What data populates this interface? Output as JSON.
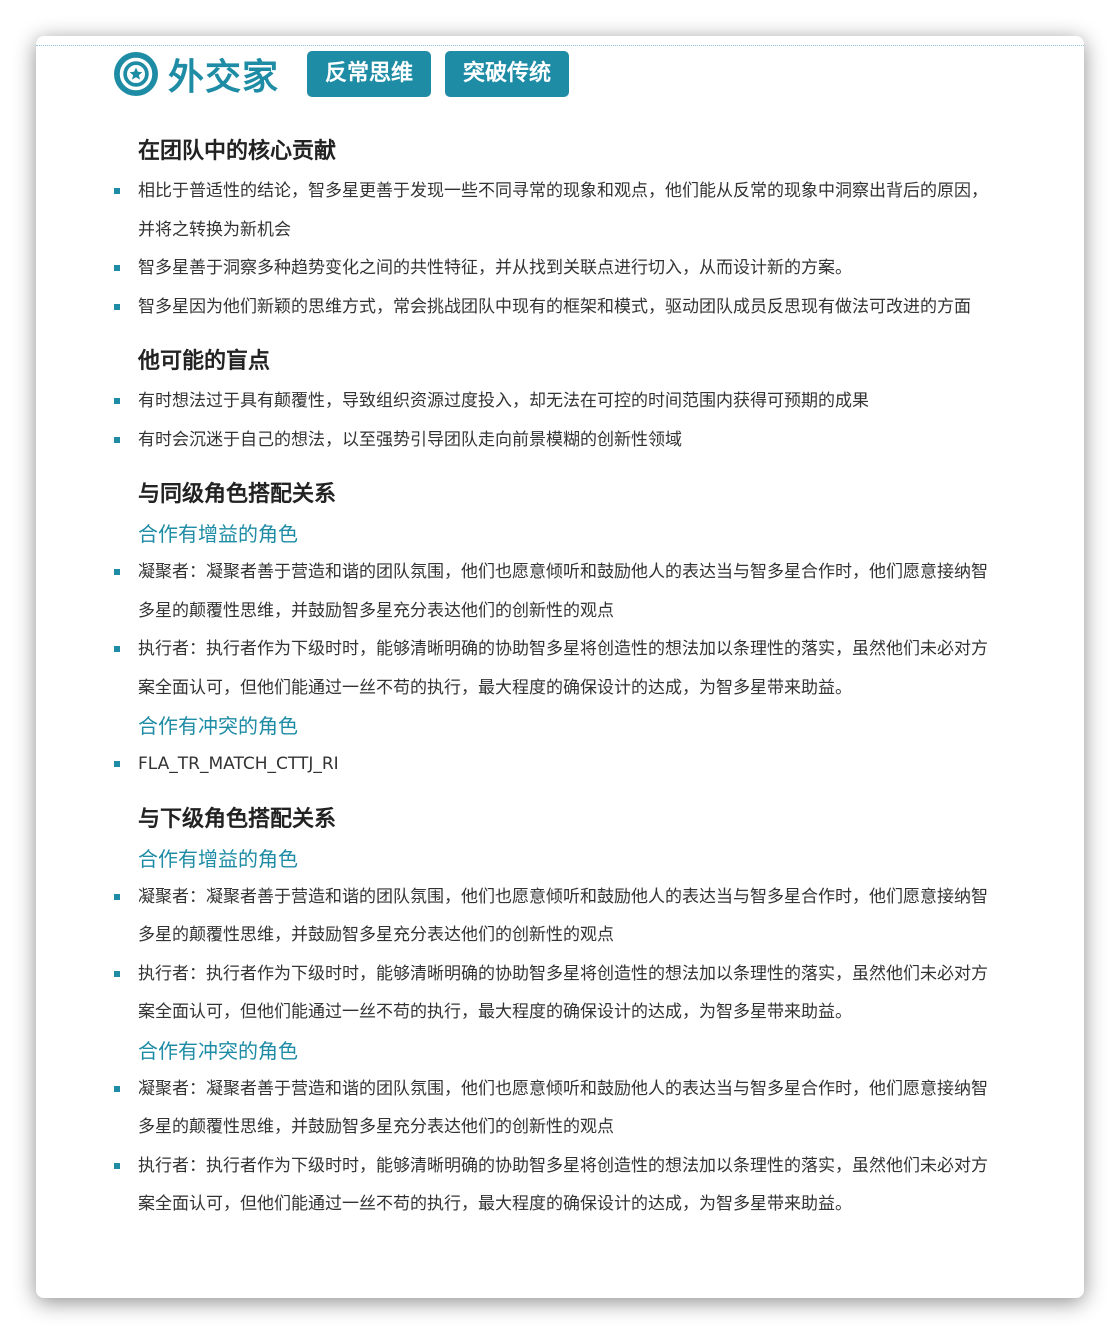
{
  "header": {
    "icon": "star-badge-icon",
    "title": "外交家",
    "tags": [
      "反常思维",
      "突破传统"
    ]
  },
  "sections": {
    "core": {
      "title": "在团队中的核心贡献",
      "items": [
        "相比于普适性的结论，智多星更善于发现一些不同寻常的现象和观点，他们能从反常的现象中洞察出背后的原因，并将之转换为新机会",
        "智多星善于洞察多种趋势变化之间的共性特征，并从找到关联点进行切入，从而设计新的方案。",
        "智多星因为他们新颖的思维方式，常会挑战团队中现有的框架和模式，驱动团队成员反思现有做法可改进的方面"
      ]
    },
    "blind": {
      "title": "他可能的盲点",
      "items": [
        "有时想法过于具有颠覆性，导致组织资源过度投入，却无法在可控的时间范围内获得可预期的成果",
        "有时会沉迷于自己的想法，以至强势引导团队走向前景模糊的创新性领域"
      ]
    },
    "peer": {
      "title": "与同级角色搭配关系",
      "gain_title": "合作有增益的角色",
      "gain_items": [
        "凝聚者：凝聚者善于营造和谐的团队氛围，他们也愿意倾听和鼓励他人的表达当与智多星合作时，他们愿意接纳智多星的颠覆性思维，并鼓励智多星充分表达他们的创新性的观点",
        "执行者：执行者作为下级时时，能够清晰明确的协助智多星将创造性的想法加以条理性的落实，虽然他们未必对方案全面认可，但他们能通过一丝不苟的执行，最大程度的确保设计的达成，为智多星带来助益。"
      ],
      "conflict_title": "合作有冲突的角色",
      "conflict_items": [
        "FLA_TR_MATCH_CTTJ_RI"
      ]
    },
    "sub": {
      "title": "与下级角色搭配关系",
      "gain_title": "合作有增益的角色",
      "gain_items": [
        "凝聚者：凝聚者善于营造和谐的团队氛围，他们也愿意倾听和鼓励他人的表达当与智多星合作时，他们愿意接纳智多星的颠覆性思维，并鼓励智多星充分表达他们的创新性的观点",
        "执行者：执行者作为下级时时，能够清晰明确的协助智多星将创造性的想法加以条理性的落实，虽然他们未必对方案全面认可，但他们能通过一丝不苟的执行，最大程度的确保设计的达成，为智多星带来助益。"
      ],
      "conflict_title": "合作有冲突的角色",
      "conflict_items": [
        "凝聚者：凝聚者善于营造和谐的团队氛围，他们也愿意倾听和鼓励他人的表达当与智多星合作时，他们愿意接纳智多星的颠覆性思维，并鼓励智多星充分表达他们的创新性的观点",
        "执行者：执行者作为下级时时，能够清晰明确的协助智多星将创造性的想法加以条理性的落实，虽然他们未必对方案全面认可，但他们能通过一丝不苟的执行，最大程度的确保设计的达成，为智多星带来助益。"
      ]
    }
  },
  "colors": {
    "accent": "#1f8ca5"
  }
}
